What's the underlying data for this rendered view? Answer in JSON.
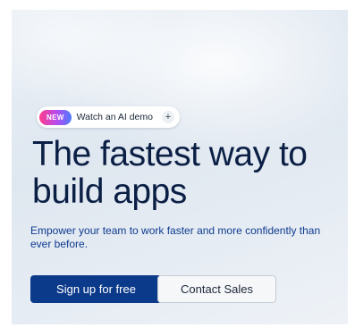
{
  "announcement": {
    "badge_label": "NEW",
    "text": "Watch an AI demo",
    "expand_symbol": "+"
  },
  "hero": {
    "headline": "The fastest way to build apps",
    "subtext": "Empower your team to work faster and more confidently than ever before."
  },
  "actions": {
    "primary_label": "Sign up for free",
    "secondary_label": "Contact Sales"
  },
  "colors": {
    "primary_button": "#0c3a8a",
    "headline": "#0b1f45",
    "subtext": "#0e3b8f",
    "badge_gradient": [
      "#ff3d8b",
      "#b54cf0",
      "#4a7dff"
    ]
  },
  "icons": {
    "expand": "plus-icon"
  }
}
